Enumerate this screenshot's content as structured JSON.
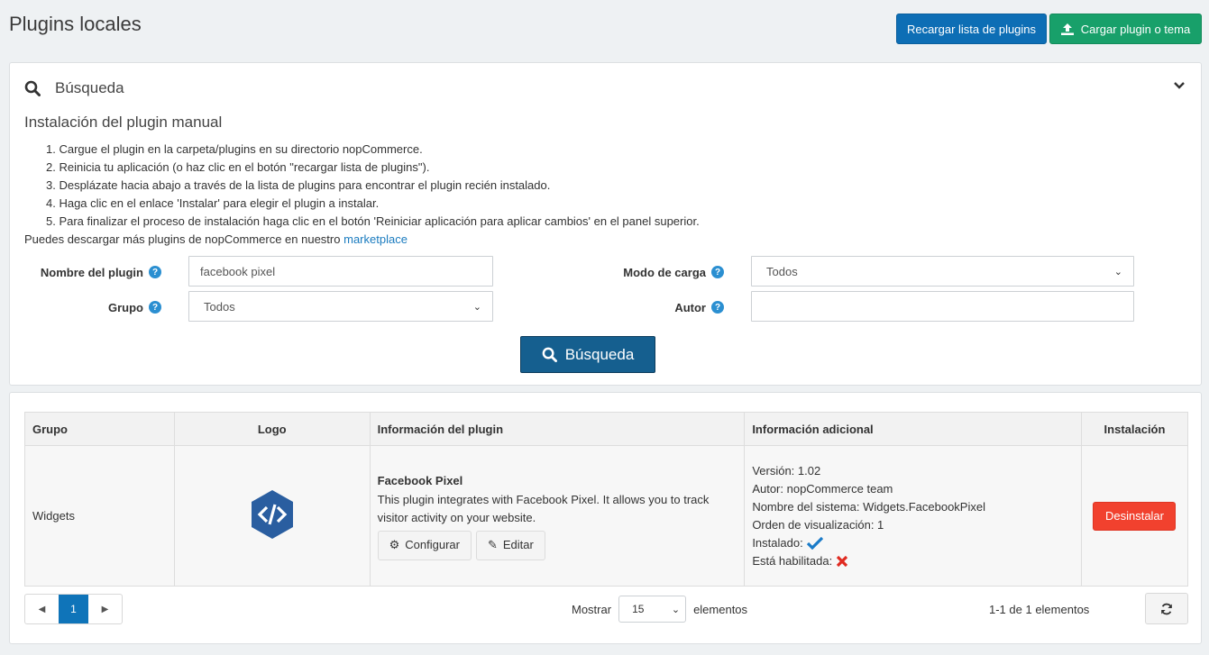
{
  "header": {
    "title": "Plugins locales",
    "reload_label": "Recargar lista de plugins",
    "upload_label": "Cargar plugin o tema"
  },
  "search": {
    "panel_title": "Búsqueda",
    "instructions_title": "Instalación del plugin manual",
    "steps": [
      "1. Cargue el plugin en la carpeta/plugins en su directorio nopCommerce.",
      "2. Reinicia tu aplicación (o haz clic en el botón \"recargar lista de plugins\").",
      "3. Desplázate hacia abajo a través de la lista de plugins para encontrar el plugin recién instalado.",
      "4. Haga clic en el enlace 'Instalar' para elegir el plugin a instalar.",
      "5. Para finalizar el proceso de instalación haga clic en el botón 'Reiniciar aplicación para aplicar cambios' en el panel superior."
    ],
    "marketplace_text": "Puedes descargar más plugins de nopCommerce en nuestro",
    "marketplace_link": "marketplace",
    "plugin_name_label": "Nombre del plugin",
    "plugin_name_value": "facebook pixel",
    "group_label": "Grupo",
    "group_value": "Todos",
    "load_mode_label": "Modo de carga",
    "load_mode_value": "Todos",
    "author_label": "Autor",
    "author_value": "",
    "search_button": "Búsqueda"
  },
  "grid": {
    "columns": [
      "Grupo",
      "Logo",
      "Información del plugin",
      "Información adicional",
      "Instalación"
    ],
    "rows": [
      {
        "group": "Widgets",
        "plugin_name": "Facebook Pixel",
        "plugin_desc": "This plugin integrates with Facebook Pixel. It allows you to track visitor activity on your website.",
        "configure_label": "Configurar",
        "edit_label": "Editar",
        "version": "Versión: 1.02",
        "author": "Autor: nopCommerce team",
        "system_name": "Nombre del sistema: Widgets.FacebookPixel",
        "display_order": "Orden de visualización: 1",
        "installed_label": "Instalado:",
        "enabled_label": "Está habilitada:",
        "uninstall_label": "Desinstalar"
      }
    ],
    "pager": {
      "current_page": "1"
    },
    "show_label": "Mostrar",
    "page_size": "15",
    "elements_label": "elementos",
    "count_text": "1-1 de 1 elementos"
  },
  "colors": {
    "primary": "#0d6eb5",
    "success": "#18a06a",
    "danger": "#f1412e",
    "search_button": "#155f8f"
  }
}
